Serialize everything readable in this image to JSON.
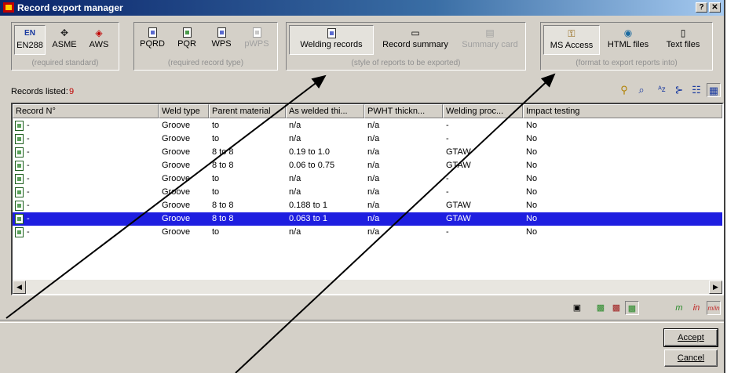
{
  "window": {
    "title": "Record export manager"
  },
  "titlebar": {
    "help": "?",
    "close": "✕"
  },
  "standards": {
    "caption": "(required standard)",
    "items": [
      {
        "label": "EN288",
        "icon": "EN",
        "pressed": true
      },
      {
        "label": "ASME",
        "icon": "✥",
        "pressed": false
      },
      {
        "label": "AWS",
        "icon": "◈",
        "pressed": false
      }
    ]
  },
  "record_types": {
    "caption": "(required record type)",
    "items": [
      {
        "label": "PQRD",
        "pressed": false,
        "disabled": false
      },
      {
        "label": "PQR",
        "pressed": false,
        "disabled": false
      },
      {
        "label": "WPS",
        "pressed": false,
        "disabled": false
      },
      {
        "label": "pWPS",
        "pressed": false,
        "disabled": true
      }
    ]
  },
  "report_styles": {
    "caption": "(style of reports to be exported)",
    "items": [
      {
        "label": "Welding records",
        "pressed": true,
        "disabled": false
      },
      {
        "label": "Record summary",
        "pressed": false,
        "disabled": false
      },
      {
        "label": "Summary card",
        "pressed": false,
        "disabled": true
      }
    ]
  },
  "formats": {
    "caption": "(format to export reports into)",
    "items": [
      {
        "label": "MS Access",
        "pressed": true
      },
      {
        "label": "HTML files",
        "pressed": false
      },
      {
        "label": "Text files",
        "pressed": false
      }
    ]
  },
  "records": {
    "label": "Records listed:",
    "count": "9"
  },
  "list": {
    "columns": [
      "Record N°",
      "Weld type",
      "Parent material",
      "As welded thi...",
      "PWHT thickn...",
      "Welding proc...",
      "Impact testing"
    ],
    "rows": [
      [
        "-",
        "Groove",
        "to",
        "n/a",
        "n/a",
        "-",
        "No"
      ],
      [
        "-",
        "Groove",
        "to",
        "n/a",
        "n/a",
        "-",
        "No"
      ],
      [
        "-",
        "Groove",
        "8 to 8",
        "0.19 to 1.0",
        "n/a",
        "GTAW",
        "No"
      ],
      [
        "-",
        "Groove",
        "8 to 8",
        "0.06 to 0.75",
        "n/a",
        "GTAW",
        "No"
      ],
      [
        "-",
        "Groove",
        "to",
        "n/a",
        "n/a",
        "-",
        "No"
      ],
      [
        "-",
        "Groove",
        "to",
        "n/a",
        "n/a",
        "-",
        "No"
      ],
      [
        "-",
        "Groove",
        "8 to 8",
        "0.188 to 1",
        "n/a",
        "GTAW",
        "No"
      ],
      [
        "-",
        "Groove",
        "8 to 8",
        "0.063 to 1",
        "n/a",
        "GTAW",
        "No"
      ],
      [
        "-",
        "Groove",
        "to",
        "n/a",
        "n/a",
        "-",
        "No"
      ]
    ],
    "selected_row": 7
  },
  "bottom_units": {
    "m": "m",
    "in": "in",
    "min": "m/in"
  },
  "buttons": {
    "accept": "Accept",
    "cancel": "Cancel"
  },
  "colors": {
    "selection": "#1e1ee0",
    "title_start": "#0a246a",
    "records_count": "#c00000"
  }
}
